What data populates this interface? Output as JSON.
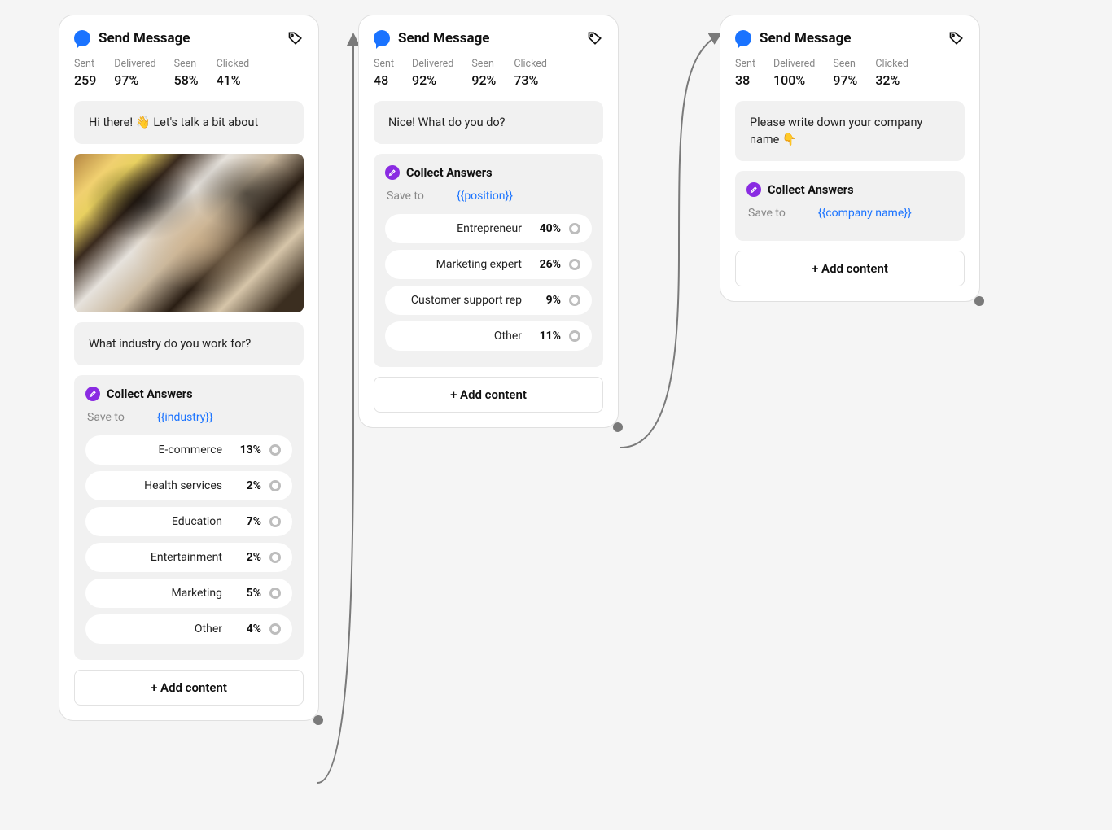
{
  "cards": [
    {
      "title": "Send Message",
      "stats": {
        "sent_label": "Sent",
        "sent_value": "259",
        "delivered_label": "Delivered",
        "delivered_value": "97%",
        "seen_label": "Seen",
        "seen_value": "58%",
        "clicked_label": "Clicked",
        "clicked_value": "41%"
      },
      "msg1": "Hi there! 👋 Let's talk a bit about",
      "msg2": "What industry do you work for?",
      "collect": {
        "title": "Collect Answers",
        "save_to_label": "Save to",
        "save_to_var": "{{industry}}",
        "answers": [
          {
            "label": "E-commerce",
            "pct": "13%"
          },
          {
            "label": "Health services",
            "pct": "2%"
          },
          {
            "label": "Education",
            "pct": "7%"
          },
          {
            "label": "Entertainment",
            "pct": "2%"
          },
          {
            "label": "Marketing",
            "pct": "5%"
          },
          {
            "label": "Other",
            "pct": "4%"
          }
        ]
      },
      "add_content": "+ Add content"
    },
    {
      "title": "Send Message",
      "stats": {
        "sent_label": "Sent",
        "sent_value": "48",
        "delivered_label": "Delivered",
        "delivered_value": "92%",
        "seen_label": "Seen",
        "seen_value": "92%",
        "clicked_label": "Clicked",
        "clicked_value": "73%"
      },
      "msg1": "Nice! What do you do?",
      "collect": {
        "title": "Collect Answers",
        "save_to_label": "Save to",
        "save_to_var": "{{position}}",
        "answers": [
          {
            "label": "Entrepreneur",
            "pct": "40%"
          },
          {
            "label": "Marketing expert",
            "pct": "26%"
          },
          {
            "label": "Customer support rep",
            "pct": "9%"
          },
          {
            "label": "Other",
            "pct": "11%"
          }
        ]
      },
      "add_content": "+ Add content"
    },
    {
      "title": "Send Message",
      "stats": {
        "sent_label": "Sent",
        "sent_value": "38",
        "delivered_label": "Delivered",
        "delivered_value": "100%",
        "seen_label": "Seen",
        "seen_value": "97%",
        "clicked_label": "Clicked",
        "clicked_value": "32%"
      },
      "msg1": "Please write down your company name 👇",
      "collect": {
        "title": "Collect Answers",
        "save_to_label": "Save to",
        "save_to_var": "{{company name}}"
      },
      "add_content": "+ Add content"
    }
  ]
}
